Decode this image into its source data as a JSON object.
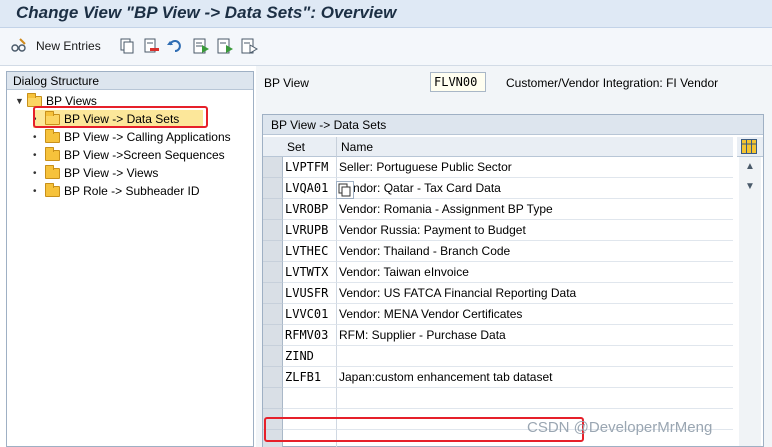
{
  "window": {
    "title": "Change View \"BP View -> Data Sets\": Overview"
  },
  "toolbar": {
    "new_entries_label": "New Entries",
    "icons": [
      "glasses-pencil-icon",
      "copy-icon",
      "delete-icon",
      "undo-icon",
      "select-all-icon",
      "select-block-icon",
      "deselect-all-icon"
    ]
  },
  "dialog_structure": {
    "header": "Dialog Structure",
    "root": "BP Views",
    "items": [
      {
        "label": "BP View -> Data Sets",
        "selected": true
      },
      {
        "label": "BP View -> Calling Applications"
      },
      {
        "label": "BP View ->Screen Sequences"
      },
      {
        "label": "BP View -> Views"
      },
      {
        "label": "BP Role -> Subheader ID"
      }
    ]
  },
  "bp_view": {
    "label": "BP View",
    "value": "FLVN00",
    "description": "Customer/Vendor Integration: FI Vendor"
  },
  "table": {
    "title": "BP View -> Data Sets",
    "columns": {
      "set": "Set",
      "name": "Name"
    },
    "rows": [
      {
        "set": "LVPTFM",
        "name": "Seller: Portuguese Public Sector"
      },
      {
        "set": "LVQA01",
        "name": "Vendor: Qatar - Tax Card Data"
      },
      {
        "set": "LVROBP",
        "name": "Vendor: Romania - Assignment BP Type"
      },
      {
        "set": "LVRUPB",
        "name": "Vendor Russia: Payment to Budget"
      },
      {
        "set": "LVTHEC",
        "name": "Vendor: Thailand - Branch Code"
      },
      {
        "set": "LVTWTX",
        "name": "Vendor: Taiwan eInvoice"
      },
      {
        "set": "LVUSFR",
        "name": "Vendor: US FATCA Financial Reporting Data"
      },
      {
        "set": "LVVC01",
        "name": "Vendor: MENA Vendor Certificates"
      },
      {
        "set": "RFMV03",
        "name": "RFM: Supplier - Purchase Data"
      },
      {
        "set": "ZIND",
        "name": ""
      },
      {
        "set": "ZLFB1",
        "name": "Japan:custom enhancement tab dataset"
      },
      {
        "set": "",
        "name": ""
      },
      {
        "set": "",
        "name": ""
      },
      {
        "set": "",
        "name": ""
      }
    ]
  },
  "watermark": "CSDN @DeveloperMrMeng",
  "colors": {
    "highlight_red": "#e6202a",
    "folder_yellow": "#f6c23b",
    "selected_row": "#fce79a"
  }
}
